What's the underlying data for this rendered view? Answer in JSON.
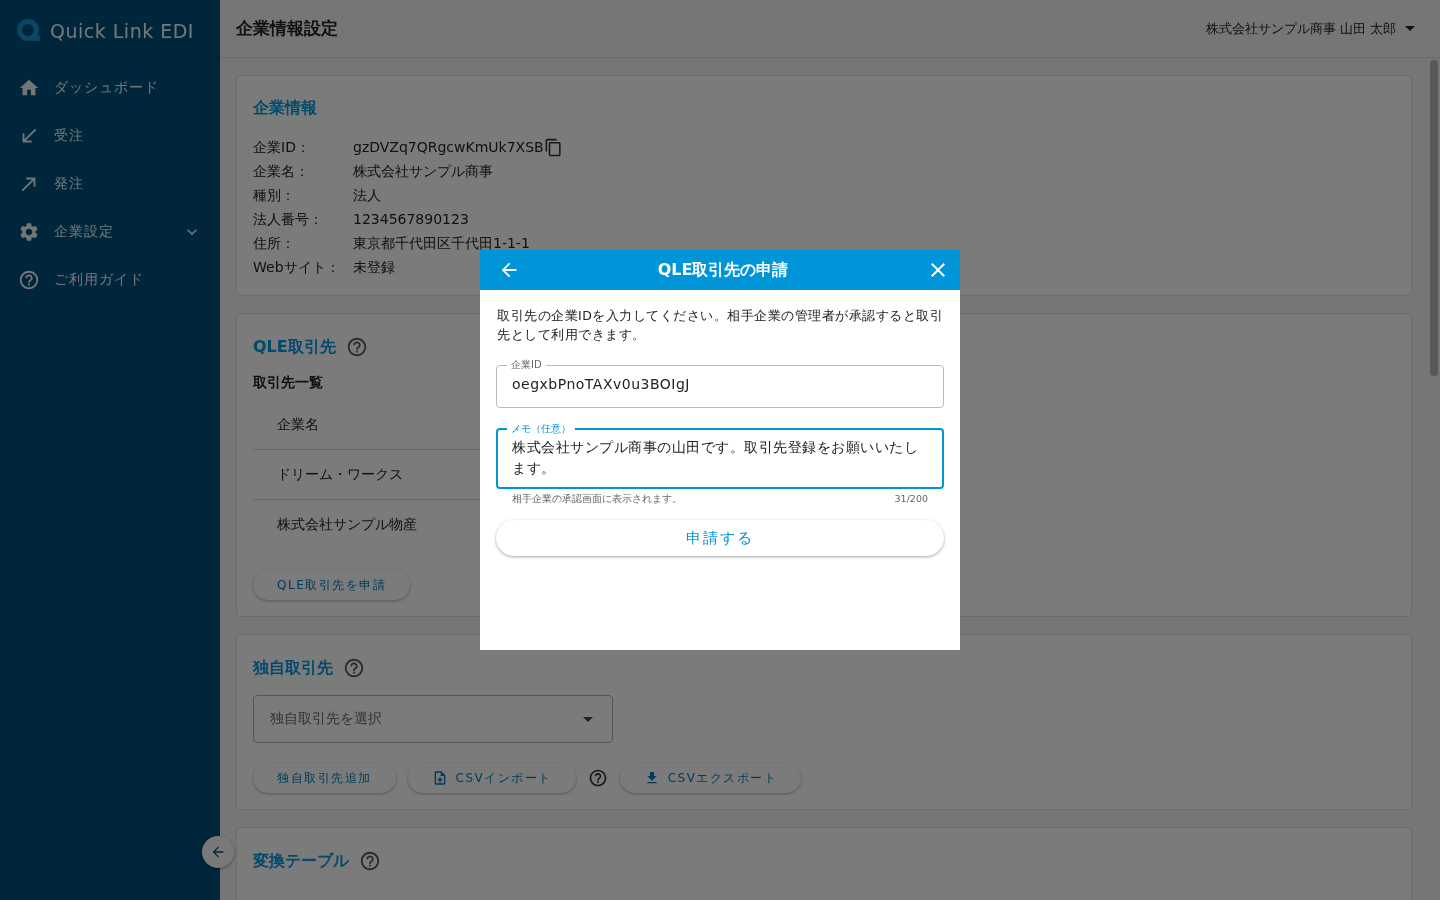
{
  "sidebar": {
    "logo": "Quick Link EDI",
    "items": [
      {
        "label": "ダッシュボード",
        "kind": "link"
      },
      {
        "label": "受注",
        "kind": "link"
      },
      {
        "label": "発注",
        "kind": "link"
      },
      {
        "label": "企業設定",
        "kind": "group",
        "expanded": false
      },
      {
        "label": "ご利用ガイド",
        "kind": "link"
      }
    ]
  },
  "header": {
    "title": "企業情報設定",
    "user": "株式会社サンプル商事 山田 太郎"
  },
  "company_info": {
    "title": "企業情報",
    "fields": [
      {
        "label": "企業ID：",
        "value": "gzDVZq7QRgcwKmUk7XSB",
        "copyable": true
      },
      {
        "label": "企業名：",
        "value": "株式会社サンプル商事",
        "copyable": false
      },
      {
        "label": "種別：",
        "value": "法人",
        "copyable": false
      },
      {
        "label": "法人番号：",
        "value": "1234567890123",
        "copyable": false
      },
      {
        "label": "住所：",
        "value": "東京都千代田区千代田1-1-1",
        "copyable": false
      },
      {
        "label": "Webサイト：",
        "value": "未登録",
        "copyable": false
      }
    ]
  },
  "qle_partners": {
    "title": "QLE取引先",
    "subtitle": "取引先一覧",
    "table": {
      "columns": [
        "企業名"
      ],
      "rows": [
        [
          "ドリーム・ワークス"
        ],
        [
          "株式会社サンプル物産"
        ]
      ]
    },
    "button": "QLE取引先を申請"
  },
  "own_partners": {
    "title": "独自取引先",
    "select_placeholder": "独自取引先を選択",
    "buttons": [
      {
        "label": "独自取引先追加",
        "kind": "plain"
      },
      {
        "label": "CSVインポート",
        "kind": "import"
      },
      {
        "label": "CSVエクスポート",
        "kind": "export"
      }
    ]
  },
  "conversion_table": {
    "title": "変換テーブル"
  },
  "dialog": {
    "title": "QLE取引先の申請",
    "description": "取引先の企業IDを入力してください。相手企業の管理者が承認すると取引先として利用できます。",
    "fields": [
      {
        "label": "企業ID",
        "value": "oegxbPnoTAXv0u3BOIgJ",
        "focused": false
      },
      {
        "label": "メモ（任意）",
        "value": "株式会社サンプル商事の山田です。取引先登録をお願いいたします。",
        "focused": true,
        "helper": "相手企業の承認画面に表示されます。",
        "counter": "31/200"
      }
    ],
    "submit": "申請する"
  }
}
